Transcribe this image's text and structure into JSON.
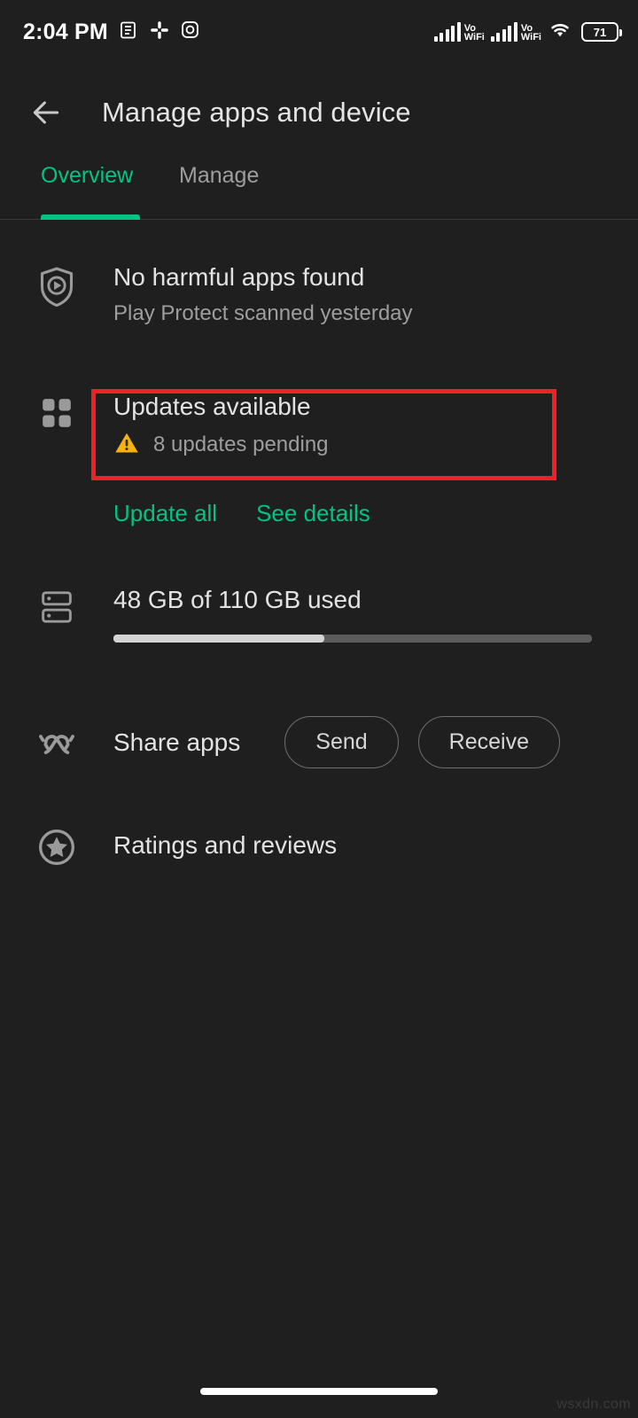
{
  "statusbar": {
    "time": "2:04 PM",
    "icons": [
      "notes-icon",
      "slack-icon",
      "instagram-icon"
    ],
    "signal_1": "VoWiFi",
    "signal_1_line1": "Vo",
    "signal_1_line2": "WiFi",
    "signal_2_line1": "Vo",
    "signal_2_line2": "WiFi",
    "wifi": "wifi-icon",
    "battery_level": "71"
  },
  "appbar": {
    "back": "back-arrow-icon",
    "title": "Manage apps and device"
  },
  "tabs": {
    "items": [
      {
        "label": "Overview",
        "selected": true
      },
      {
        "label": "Manage",
        "selected": false
      }
    ],
    "accent": "#03c383"
  },
  "content": {
    "play_protect": {
      "icon": "play-protect-shield-icon",
      "title": "No harmful apps found",
      "subtitle": "Play Protect scanned yesterday"
    },
    "updates": {
      "icon": "apps-grid-icon",
      "title": "Updates available",
      "warning_icon": "warning-triangle-icon",
      "subtitle": "8 updates pending",
      "highlight_color": "#ee2224",
      "actions": [
        {
          "label": "Update all"
        },
        {
          "label": "See details"
        }
      ]
    },
    "storage": {
      "icon": "storage-icon",
      "title": "48 GB of 110 GB used",
      "used_gb": 48,
      "total_gb": 110,
      "percent_used": 44
    },
    "share": {
      "icon": "share-apps-icon",
      "title": "Share apps",
      "buttons": [
        {
          "label": "Send"
        },
        {
          "label": "Receive"
        }
      ]
    },
    "ratings": {
      "icon": "star-circle-icon",
      "title": "Ratings and reviews"
    }
  },
  "footer": {
    "watermark": "wsxdn.com"
  }
}
